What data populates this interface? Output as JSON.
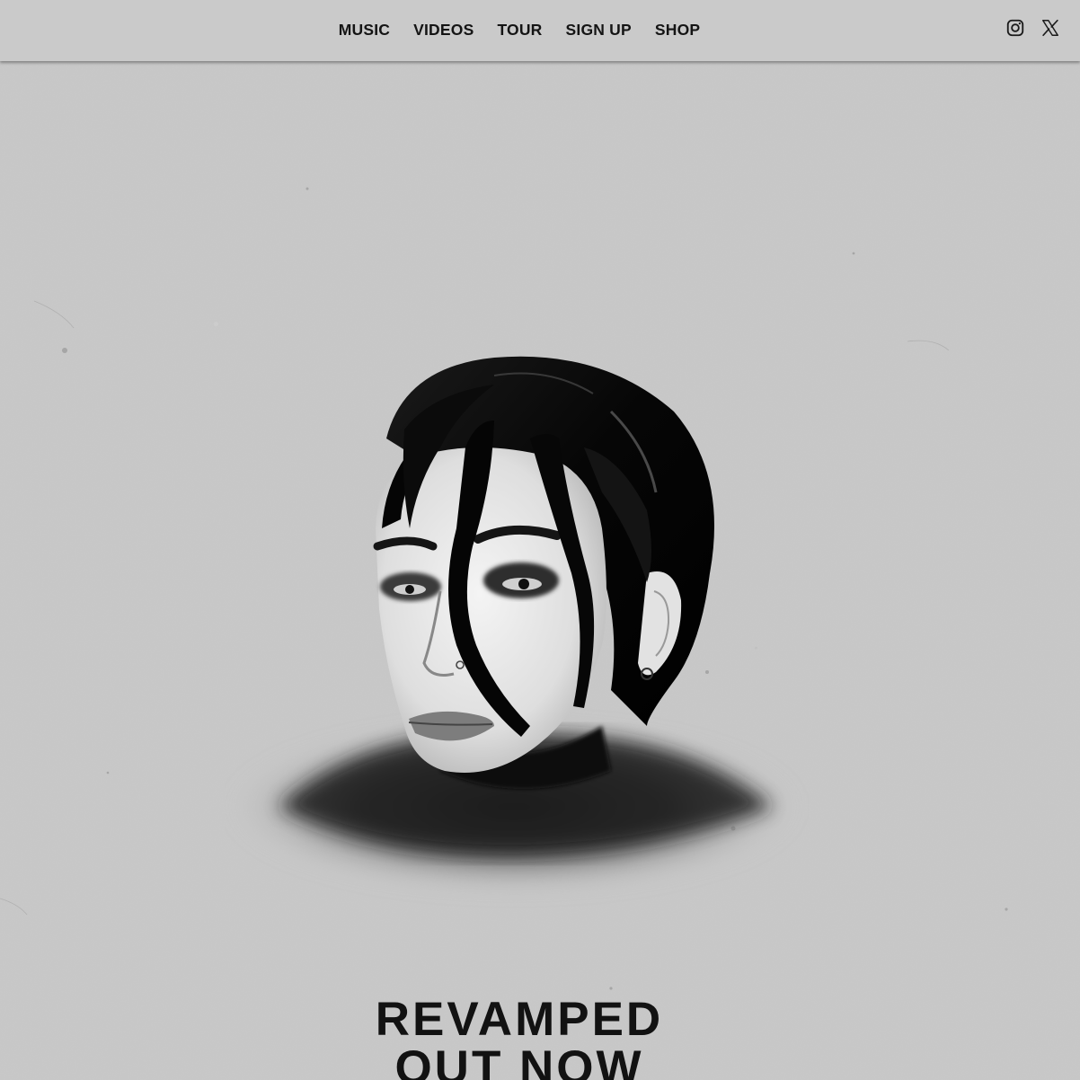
{
  "nav": {
    "items": [
      {
        "label": "MUSIC"
      },
      {
        "label": "VIDEOS"
      },
      {
        "label": "TOUR"
      },
      {
        "label": "SIGN UP"
      },
      {
        "label": "SHOP"
      }
    ]
  },
  "social": [
    {
      "icon": "instagram-icon"
    },
    {
      "icon": "x-icon"
    }
  ],
  "hero": {
    "headline_line_1": "REVAMPED",
    "headline_line_2": "OUT NOW"
  },
  "colors": {
    "background": "#c8c8c8",
    "text": "#121212",
    "header_background": "#cacaca"
  }
}
